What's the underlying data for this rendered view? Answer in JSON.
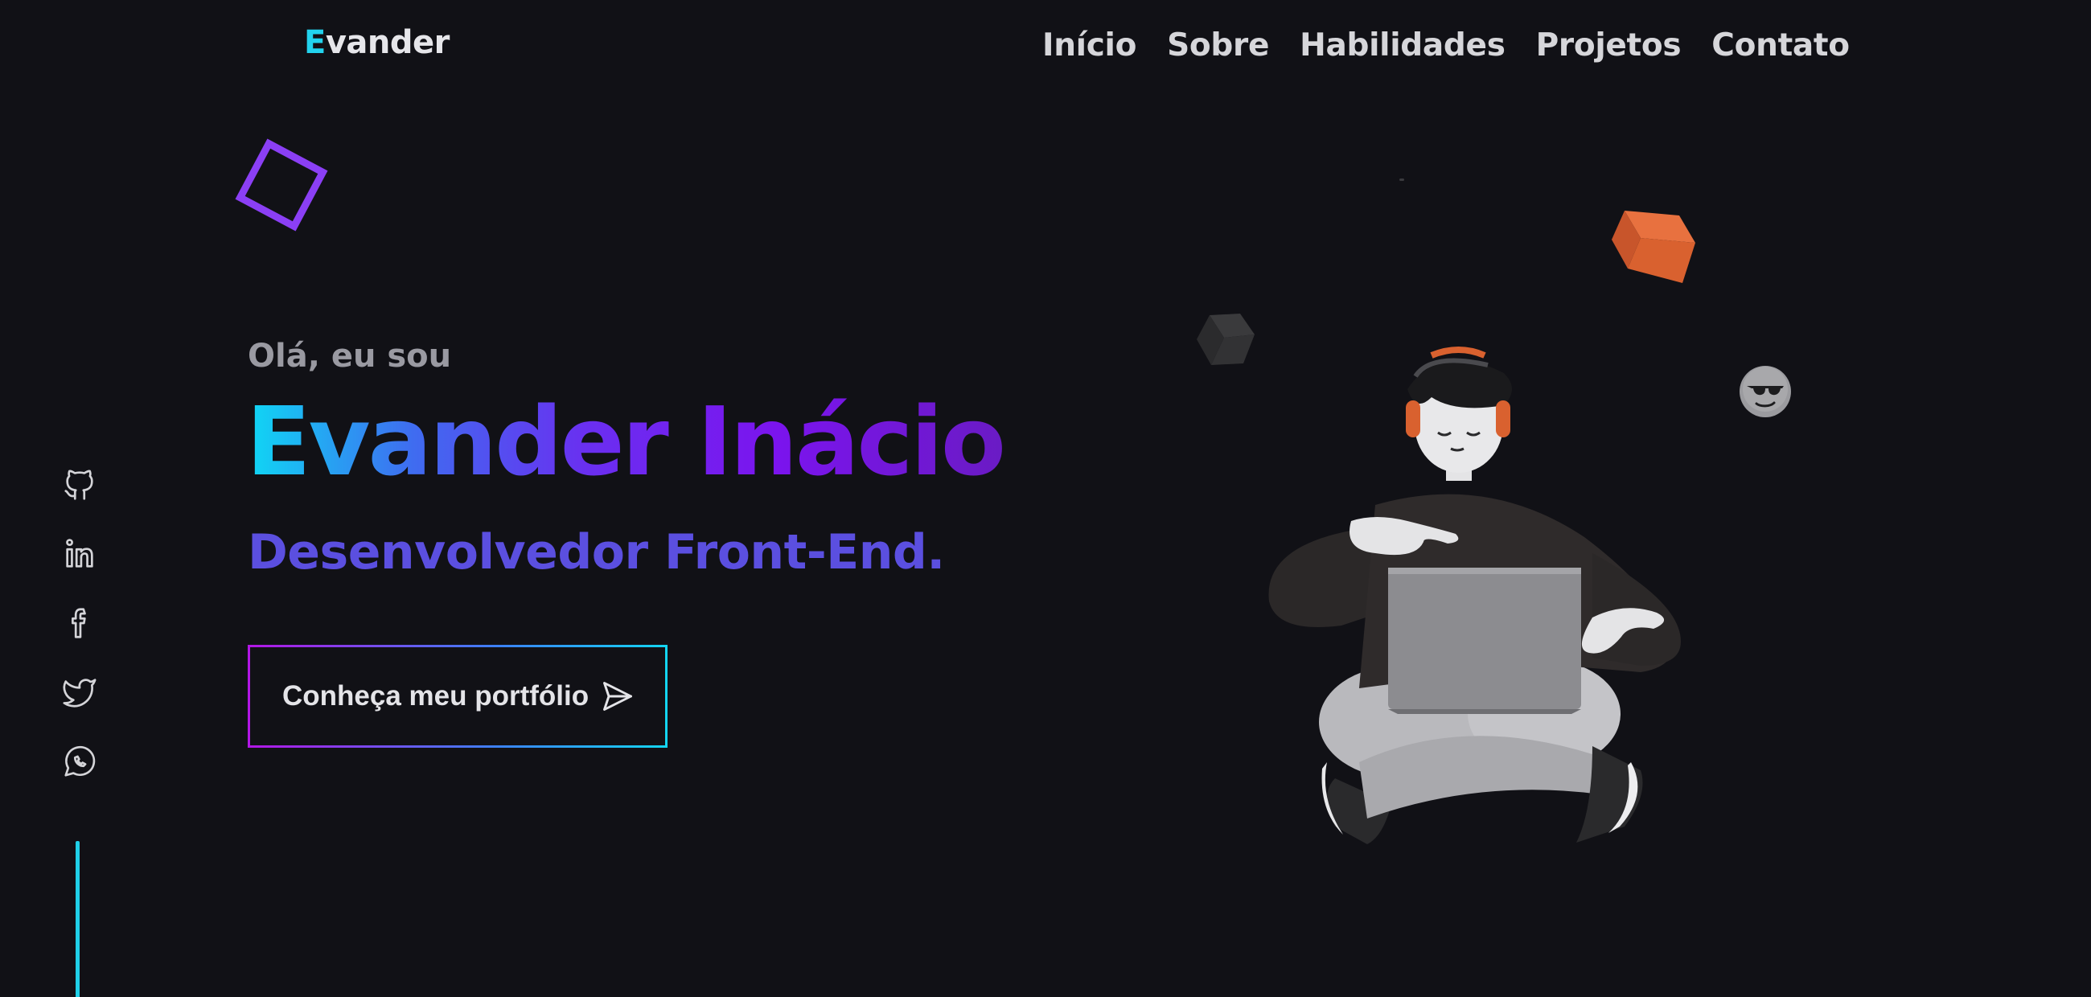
{
  "header": {
    "logo_first": "E",
    "logo_rest": "vander",
    "nav": [
      {
        "label": "Início"
      },
      {
        "label": "Sobre"
      },
      {
        "label": "Habilidades"
      },
      {
        "label": "Projetos"
      },
      {
        "label": "Contato"
      }
    ]
  },
  "social": [
    {
      "icon": "github-icon"
    },
    {
      "icon": "linkedin-icon"
    },
    {
      "icon": "facebook-icon"
    },
    {
      "icon": "twitter-icon"
    },
    {
      "icon": "whatsapp-icon"
    }
  ],
  "hero": {
    "greeting": "Olá, eu sou",
    "name": "Evander Inácio",
    "role": "Desenvolvedor Front-End.",
    "cta_label": "Conheça meu portfólio",
    "cta_icon": "send-icon"
  },
  "colors": {
    "background": "#111116",
    "accent_cyan": "#22d3ee",
    "accent_purple": "#7b14ee",
    "role_color": "#5b4fe0"
  }
}
